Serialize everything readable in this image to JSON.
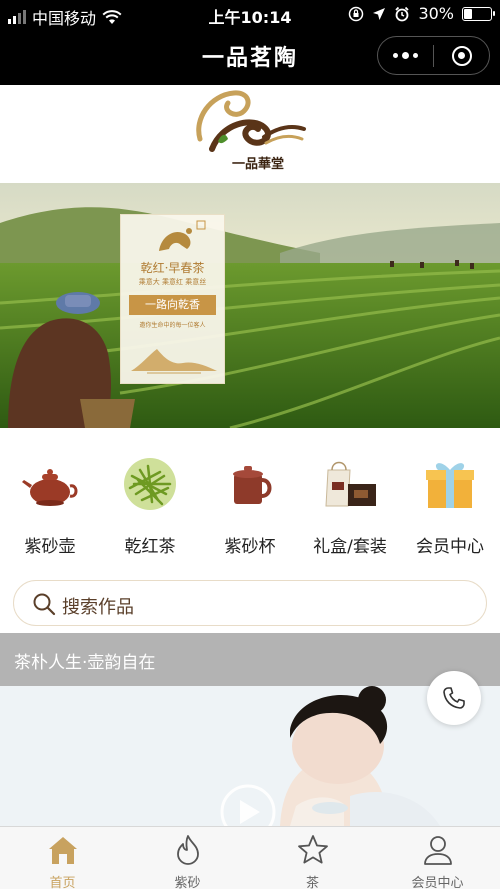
{
  "status_bar": {
    "carrier": "中国移动",
    "time": "上午10:14",
    "battery": "30%",
    "battery_level": 0.3
  },
  "nav": {
    "title": "一品茗陶"
  },
  "logo": {
    "text": "一品華堂"
  },
  "banner": {
    "brand": "乾红·早春茶",
    "sub": "乘意大 乘意红 乘意丝",
    "slogan": "一路向乾香",
    "small": "邀你生命中的每一位客人"
  },
  "categories": [
    {
      "label": "紫砂壶",
      "icon": "teapot-icon"
    },
    {
      "label": "乾红茶",
      "icon": "tea-leaves-icon"
    },
    {
      "label": "紫砂杯",
      "icon": "clay-cup-icon"
    },
    {
      "label": "礼盒/套装",
      "icon": "gift-set-icon"
    },
    {
      "label": "会员中心",
      "icon": "gift-box-icon"
    }
  ],
  "search": {
    "placeholder": "搜索作品"
  },
  "section": {
    "title": "茶朴人生·壶韵自在"
  },
  "tabbar": [
    {
      "label": "首页",
      "icon": "home-icon",
      "active": true
    },
    {
      "label": "紫砂",
      "icon": "flame-icon",
      "active": false
    },
    {
      "label": "茶",
      "icon": "star-icon",
      "active": false
    },
    {
      "label": "会员中心",
      "icon": "user-icon",
      "active": false
    }
  ],
  "colors": {
    "accent": "#c8a25f",
    "nav_bg": "#000000",
    "section_bar": "#b3b3b3"
  }
}
